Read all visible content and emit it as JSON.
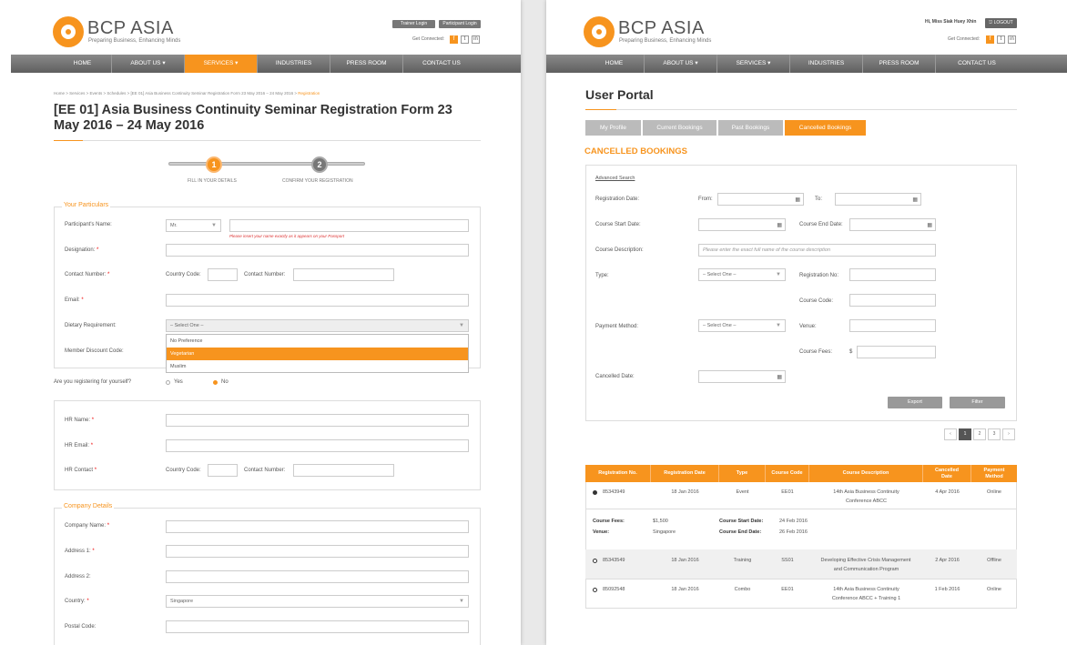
{
  "brand": {
    "name": "BCP ASIA",
    "tagline": "Preparing Business, Enhancing Minds",
    "reg": "®"
  },
  "left": {
    "trainer_login": "Trainer Login",
    "participant_login": "Participant Login",
    "get_connected": "Get Connected:",
    "nav": [
      "HOME",
      "ABOUT US",
      "SERVICES",
      "INDUSTRIES",
      "PRESS ROOM",
      "CONTACT US"
    ],
    "breadcrumb": "Home  >  Services  >  Events  >  Schedules  >  [EE 01] Asia Business Continuity Seminar Registration Form 23 May 2016 – 24 May 2016  >",
    "breadcrumb_current": "Registration",
    "title": "[EE 01] Asia Business Continuity Seminar Registration Form 23 May 2016 – 24 May 2016",
    "steps": [
      {
        "num": "1",
        "label": "FILL IN YOUR DETAILS"
      },
      {
        "num": "2",
        "label": "CONFIRM YOUR REGISTRATION"
      }
    ],
    "particulars": {
      "legend": "Your Particulars",
      "name_label": "Participant's Name:",
      "salutation": "Mr.",
      "name_hint": "Please insert your name exactly as it appears on your Passport",
      "designation_label": "Designation:",
      "contact_label": "Contact Number:",
      "country_code_label": "Country Code:",
      "contact_number_label": "Contact Number:",
      "email_label": "Email:",
      "dietary_label": "Dietary Requirement:",
      "dietary_value": "– Select One –",
      "dietary_options": [
        "No Preference",
        "Vegetarian",
        "Muslim"
      ],
      "discount_label": "Member Discount Code:"
    },
    "self_question": "Are you registering for yourself?",
    "yes": "Yes",
    "no": "No",
    "hr": {
      "name_label": "HR Name:",
      "email_label": "HR Email:",
      "contact_label": "HR Contact",
      "country_code_label": "Country Code:",
      "contact_number_label": "Contact Number:"
    },
    "company": {
      "legend": "Company Details",
      "name_label": "Company Name:",
      "address1_label": "Address 1:",
      "address2_label": "Address 2:",
      "country_label": "Country:",
      "country_value": "Singapore",
      "postal_label": "Postal Code:"
    },
    "req": "*"
  },
  "right": {
    "greeting": "Hi, Miss Siak Huey Xhin",
    "logout": "LOGOUT",
    "get_connected": "Get Connected:",
    "nav": [
      "HOME",
      "ABOUT US",
      "SERVICES",
      "INDUSTRIES",
      "PRESS ROOM",
      "CONTACT US"
    ],
    "portal_title": "User Portal",
    "tabs": [
      "My Profile",
      "Current Bookings",
      "Past Bookings",
      "Cancelled Bookings"
    ],
    "section_title": "CANCELLED BOOKINGS",
    "filter": {
      "advanced": "Advanced Search",
      "reg_date": "Registration Date:",
      "from": "From:",
      "to": "To:",
      "course_start": "Course Start Date:",
      "course_end": "Course End Date:",
      "course_desc": "Course Description:",
      "course_desc_ph": "Please enter the exact full name of the course description",
      "type": "Type:",
      "select_one": "– Select One –",
      "reg_no": "Registration No:",
      "course_code": "Course Code:",
      "payment": "Payment Method:",
      "venue": "Venue:",
      "fees": "Course Fees:",
      "dollar": "$",
      "cancelled_date": "Cancelled Date:",
      "export": "Export",
      "filter": "Filter"
    },
    "pagination": [
      "‹",
      "1",
      "2",
      "3",
      "›"
    ],
    "columns": [
      "Registration No.",
      "Registration Date",
      "Type",
      "Course Code",
      "Course Description",
      "Cancelled Date",
      "Payment Method"
    ],
    "rows": [
      {
        "no": "85343949",
        "date": "18 Jan 2016",
        "type": "Event",
        "code": "EE01",
        "desc1": "14th Asia Business Continuity",
        "desc2": "Conference ABCC",
        "cancelled": "4 Apr 2016",
        "payment": "Online"
      },
      {
        "no": "85343549",
        "date": "18 Jan 2016",
        "type": "Training",
        "code": "SS01",
        "desc1": "Developing Effective Crisis Management",
        "desc2": "and Communication Program",
        "cancelled": "2 Apr 2016",
        "payment": "Offline"
      },
      {
        "no": "85092548",
        "date": "18 Jan 2016",
        "type": "Combo",
        "code": "EE01",
        "desc1": "14th Asia Business Continuity",
        "desc2": "Conference ABCC + Training 1",
        "cancelled": "1 Feb 2016",
        "payment": "Online"
      }
    ],
    "detail": {
      "fees_label": "Course Fees:",
      "fees": "$1,500",
      "venue_label": "Venue:",
      "venue": "Singapore",
      "start_label": "Course Start Date:",
      "start": "24 Feb 2016",
      "end_label": "Course End Date:",
      "end": "26 Feb 2016"
    }
  },
  "colors": {
    "accent": "#f7941e",
    "nav": "#6f6f6f"
  }
}
